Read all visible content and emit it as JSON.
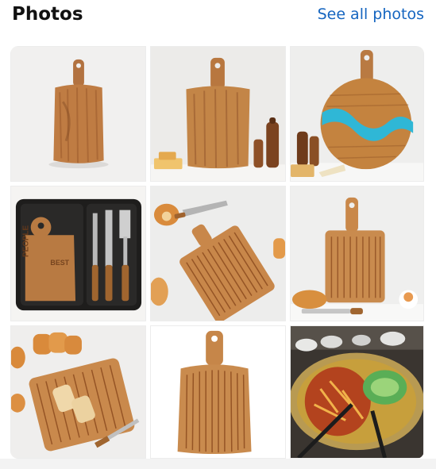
{
  "header": {
    "title": "Photos",
    "see_all_label": "See all photos"
  },
  "colors": {
    "link": "#1565c0",
    "title": "#111111",
    "wood_light": "#c98a4e",
    "wood_dark": "#8a4f24"
  },
  "photos": [
    {
      "name": "photo-1",
      "subject": "acacia cutting board with handle"
    },
    {
      "name": "photo-2",
      "subject": "cutting board with pepper mills and cheese"
    },
    {
      "name": "photo-3",
      "subject": "round board with blue resin river"
    },
    {
      "name": "photo-4",
      "subject": "bbq tool set in black case with board",
      "printed_text": "PEOPLE WHO EAT THE BEST"
    },
    {
      "name": "photo-5",
      "subject": "grooved board with cheese knife and bread"
    },
    {
      "name": "photo-6",
      "subject": "grooved paddle board with bread and knife"
    },
    {
      "name": "photo-7",
      "subject": "grooved board with sliced bread"
    },
    {
      "name": "photo-8",
      "subject": "grooved paddle board on white"
    },
    {
      "name": "photo-9",
      "subject": "hot pot with chopsticks"
    }
  ]
}
